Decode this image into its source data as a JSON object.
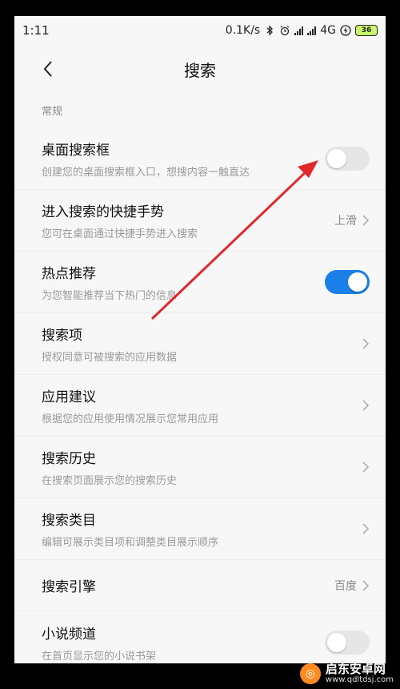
{
  "status_bar": {
    "time": "1:11",
    "speed": "0.1K/s",
    "network": "4G",
    "battery": "36"
  },
  "header": {
    "title": "搜索"
  },
  "section": {
    "label": "常规"
  },
  "rows": [
    {
      "title": "桌面搜索框",
      "desc": "创建您的桌面搜索框入口，想搜内容一触直达",
      "control": "switch",
      "on": false
    },
    {
      "title": "进入搜索的快捷手势",
      "desc": "您可在桌面通过快捷手势进入搜索",
      "control": "value",
      "value": "上滑"
    },
    {
      "title": "热点推荐",
      "desc": "为您智能推荐当下热门的信息",
      "control": "switch",
      "on": true
    },
    {
      "title": "搜索项",
      "desc": "授权同意可被搜索的应用数据",
      "control": "chevron"
    },
    {
      "title": "应用建议",
      "desc": "根据您的应用使用情况展示您常用应用",
      "control": "chevron"
    },
    {
      "title": "搜索历史",
      "desc": "在搜索页面展示您的搜索历史",
      "control": "chevron"
    },
    {
      "title": "搜索类目",
      "desc": "编辑可展示类目项和调整类目展示顺序",
      "control": "chevron"
    },
    {
      "title": "搜索引擎",
      "desc": "",
      "control": "value",
      "value": "百度"
    },
    {
      "title": "小说频道",
      "desc": "在首页显示您的小说书架",
      "control": "switch",
      "on": false
    }
  ],
  "watermark": {
    "title": "启东安卓网",
    "url": "www.qdltdsj.com"
  },
  "colors": {
    "accent": "#1a7fe6",
    "annotation_arrow": "#e0282c"
  },
  "icons": {
    "back": "chevron-left-icon",
    "row_more": "chevron-right-icon"
  }
}
